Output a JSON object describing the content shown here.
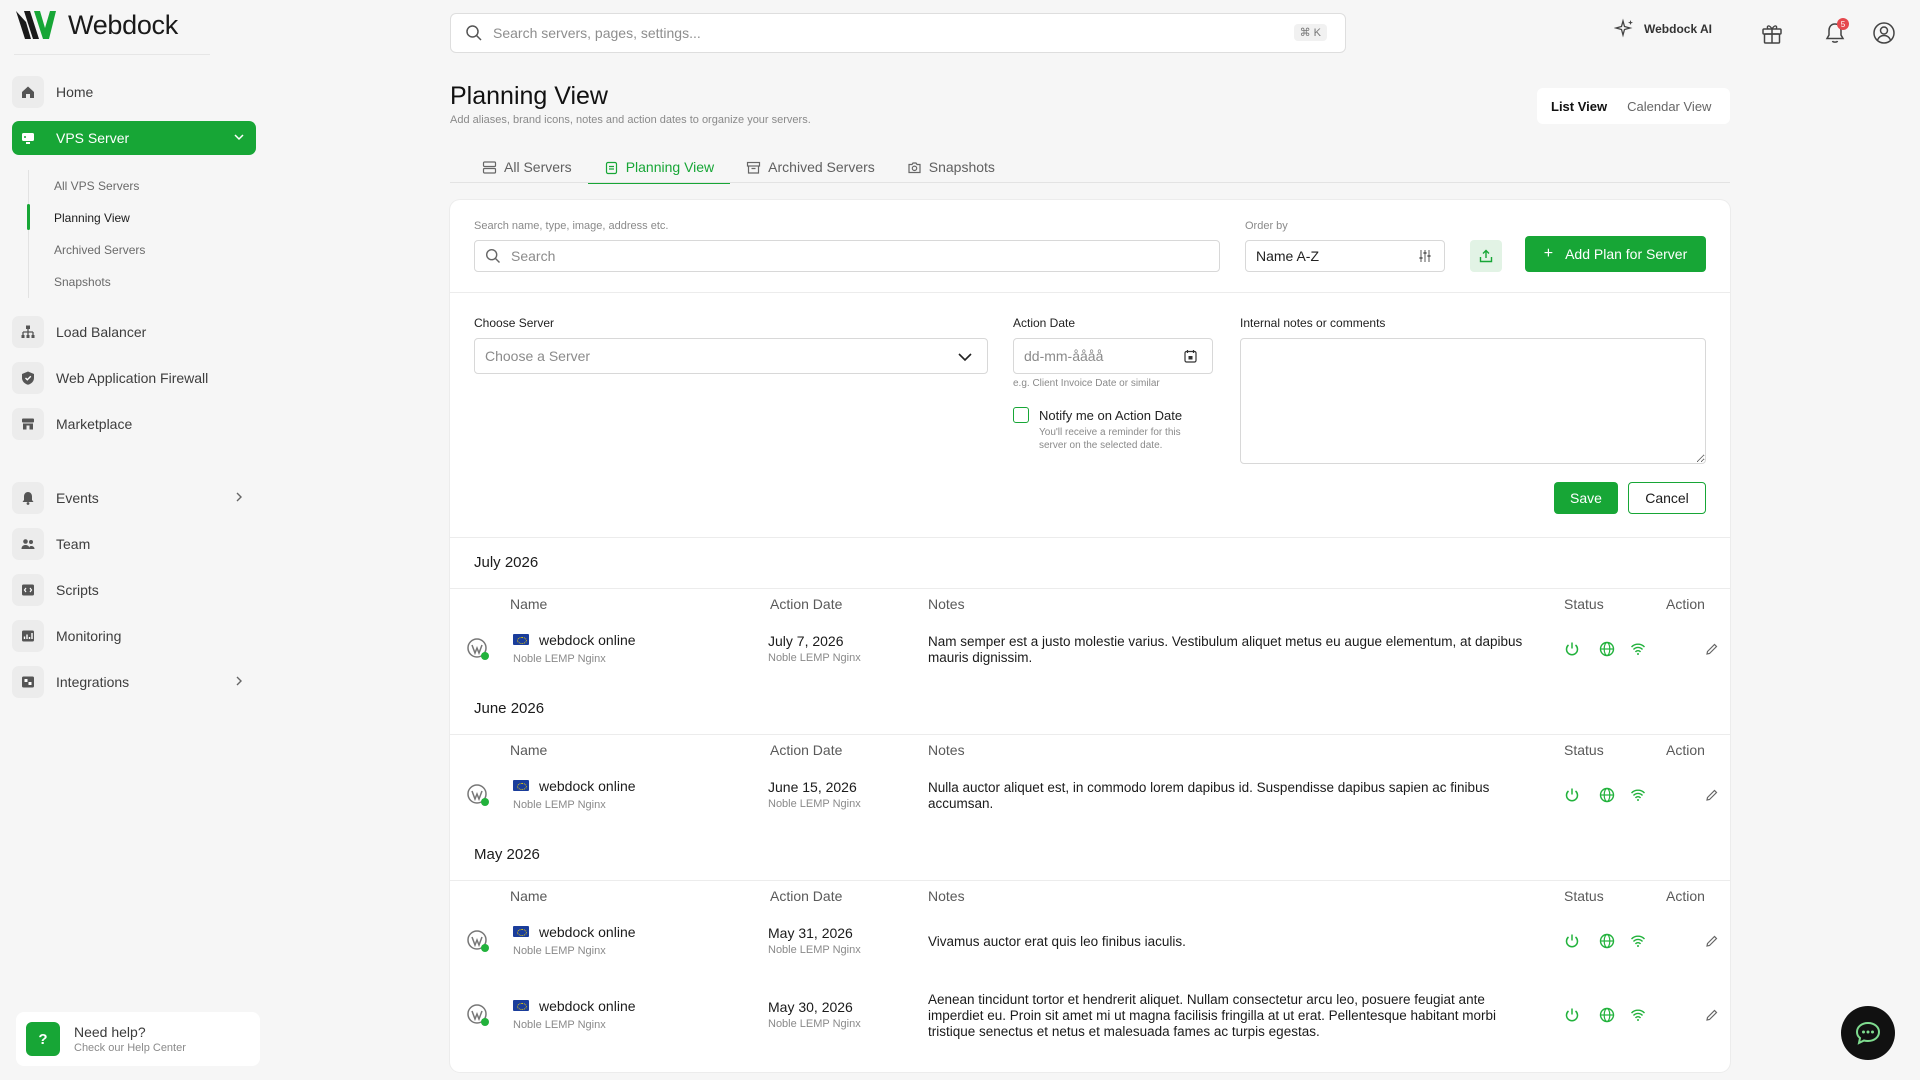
{
  "app": {
    "brand": "Webdock"
  },
  "sidebar": {
    "items": [
      {
        "label": "Home",
        "icon": "home-icon"
      },
      {
        "label": "VPS Server",
        "icon": "server-icon"
      },
      {
        "label": "Load Balancer",
        "icon": "load-balancer-icon"
      },
      {
        "label": "Web Application Firewall",
        "icon": "shield-icon"
      },
      {
        "label": "Marketplace",
        "icon": "store-icon"
      },
      {
        "label": "Events",
        "icon": "bell-icon"
      },
      {
        "label": "Team",
        "icon": "team-icon"
      },
      {
        "label": "Scripts",
        "icon": "code-icon"
      },
      {
        "label": "Monitoring",
        "icon": "chart-icon"
      },
      {
        "label": "Integrations",
        "icon": "puzzle-icon"
      }
    ],
    "vps_sub": [
      "All VPS Servers",
      "Planning View",
      "Archived Servers",
      "Snapshots"
    ],
    "help": {
      "title": "Need help?",
      "subtitle": "Check our Help Center"
    }
  },
  "topbar": {
    "search_placeholder": "Search servers, pages, settings...",
    "shortcut": "⌘ K",
    "ai_label": "Webdock AI",
    "notification_count": "5"
  },
  "page": {
    "title": "Planning View",
    "subtitle": "Add aliases, brand icons, notes and action dates to organize your servers.",
    "views": [
      "List View",
      "Calendar View"
    ],
    "tabs": [
      "All Servers",
      "Planning View",
      "Archived Servers",
      "Snapshots"
    ]
  },
  "filters": {
    "search_label": "Search name, type, image, address etc.",
    "search_placeholder": "Search",
    "order_label": "Order by",
    "order_value": "Name A-Z",
    "add_plan_label": "Add Plan for Server"
  },
  "form": {
    "server_label": "Choose Server",
    "server_placeholder": "Choose a Server",
    "date_label": "Action Date",
    "date_placeholder": "dd-mm-åååå",
    "date_hint": "e.g. Client Invoice Date or similar",
    "notify_label": "Notify me on Action Date",
    "notify_hint_1": "You'll receive a reminder for this",
    "notify_hint_2": "server on the selected date.",
    "notes_label": "Internal notes or comments",
    "save_label": "Save",
    "cancel_label": "Cancel"
  },
  "table_headers": {
    "name": "Name",
    "date": "Action Date",
    "notes": "Notes",
    "status": "Status",
    "action": "Action"
  },
  "groups": [
    {
      "title": "July 2026",
      "rows": [
        {
          "name": "webdock online",
          "stack": "Noble LEMP Nginx",
          "date": "July 7, 2026",
          "date_sub": "Noble LEMP Nginx",
          "notes": "Nam semper est a justo molestie varius. Vestibulum aliquet metus eu augue elementum, at dapibus mauris dignissim."
        }
      ]
    },
    {
      "title": "June 2026",
      "rows": [
        {
          "name": "webdock online",
          "stack": "Noble LEMP Nginx",
          "date": "June 15, 2026",
          "date_sub": "Noble LEMP Nginx",
          "notes": "Nulla auctor aliquet est, in commodo lorem dapibus id. Suspendisse dapibus sapien ac finibus accumsan."
        }
      ]
    },
    {
      "title": "May 2026",
      "rows": [
        {
          "name": "webdock online",
          "stack": "Noble LEMP Nginx",
          "date": "May 31, 2026",
          "date_sub": "Noble LEMP Nginx",
          "notes": "Vivamus auctor erat quis leo finibus iaculis."
        },
        {
          "name": "webdock online",
          "stack": "Noble LEMP Nginx",
          "date": "May 30, 2026",
          "date_sub": "Noble LEMP Nginx",
          "notes": "Aenean tincidunt tortor et hendrerit aliquet. Nullam consectetur arcu leo, posuere feugiat ante imperdiet eu. Proin sit amet mi ut magna facilisis fringilla at ut erat. Pellentesque habitant morbi tristique senectus et netus et malesuada fames ac turpis egestas."
        }
      ]
    }
  ],
  "colors": {
    "brand_green": "#17a636",
    "status_green": "#22b23c",
    "background": "#f6f6f6"
  }
}
